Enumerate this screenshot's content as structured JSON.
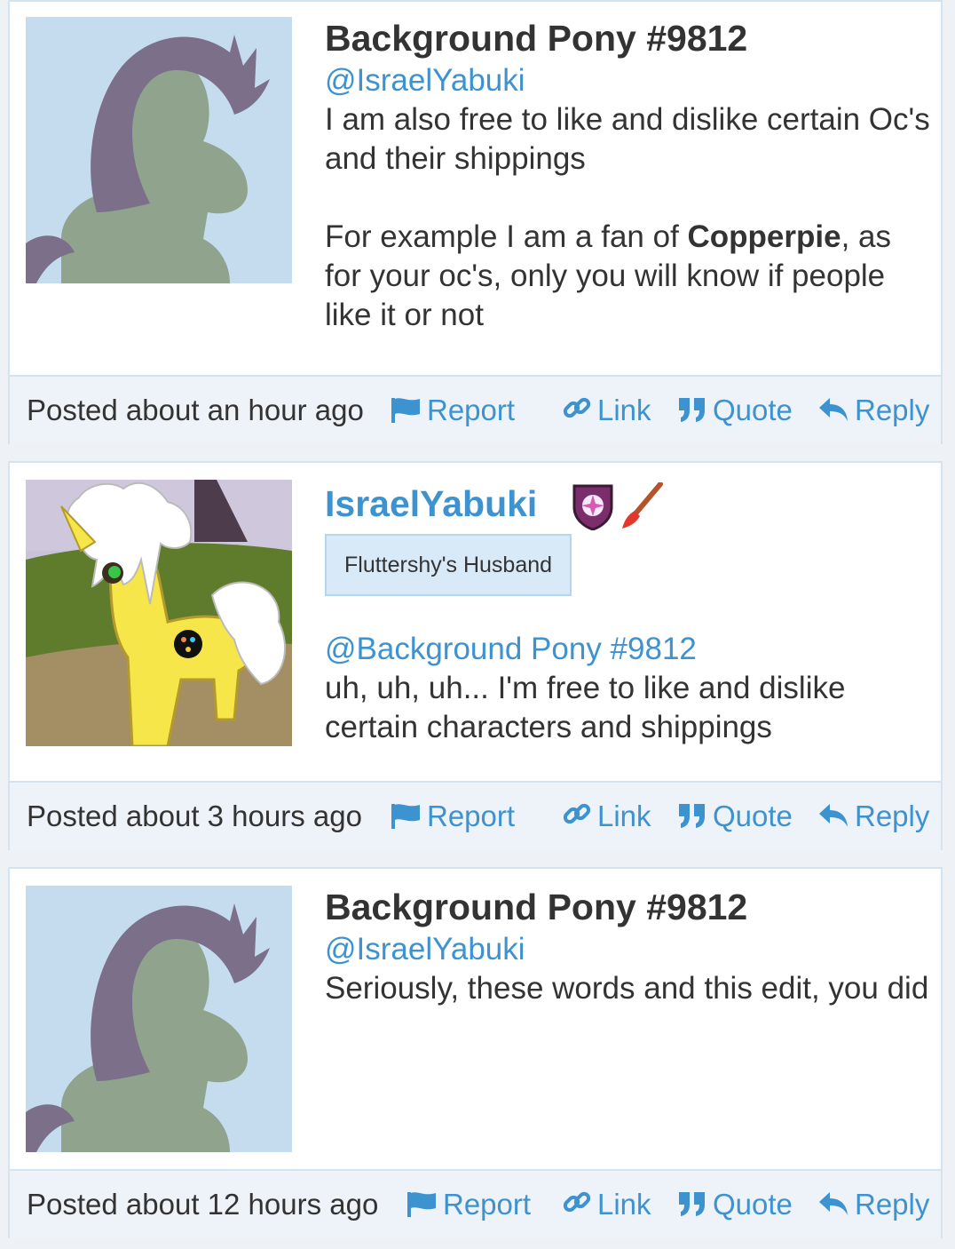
{
  "posts": [
    {
      "author": "Background Pony #9812",
      "mention": "@IsraelYabuki",
      "paragraphs": [
        "I am also free to like and dislike certain Oc's and their shippings"
      ],
      "para2_before": "For example I am a fan of ",
      "para2_bold": "Copperpie",
      "para2_after": ", as for your oc's, only you will know if people like it or not",
      "timestamp": "Posted about an hour ago",
      "actions": {
        "report": "Report",
        "link": "Link",
        "quote": "Quote",
        "reply": "Reply"
      }
    },
    {
      "author": "IsraelYabuki",
      "title": "Fluttershy's Husband",
      "mention": "@Background Pony #9812",
      "paragraphs": [
        "uh, uh, uh... I'm free to like and dislike certain characters and shippings"
      ],
      "timestamp": "Posted about 3 hours ago",
      "actions": {
        "report": "Report",
        "link": "Link",
        "quote": "Quote",
        "reply": "Reply"
      }
    },
    {
      "author": "Background Pony #9812",
      "mention": "@IsraelYabuki",
      "paragraphs": [
        "Seriously, these words and this edit, you did"
      ],
      "timestamp": "Posted about 12 hours ago",
      "actions": {
        "report": "Report",
        "link": "Link",
        "quote": "Quote",
        "reply": "Reply"
      }
    }
  ],
  "colors": {
    "link_blue": "#3d92d0",
    "footer_bg": "#edf3f9",
    "border": "#d3e3ef",
    "avatar_bg": "#c5dcef"
  },
  "icons": {
    "report": "flag-icon",
    "link": "link-icon",
    "quote": "quote-icon",
    "reply": "reply-icon",
    "badge1": "shield-badge-icon",
    "badge2": "paintbrush-badge-icon"
  }
}
